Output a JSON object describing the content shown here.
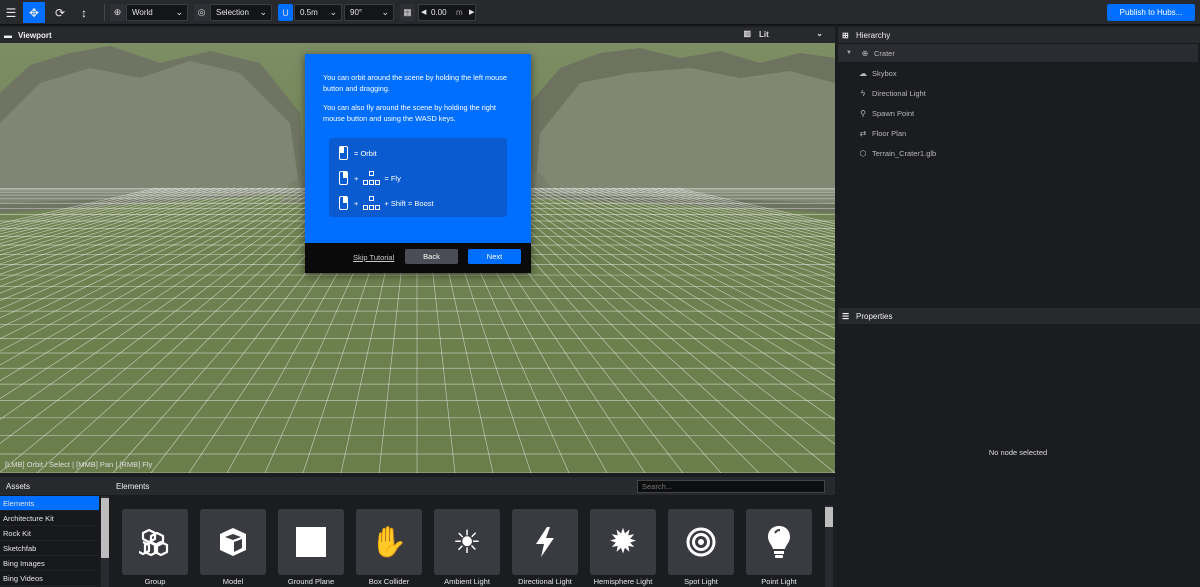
{
  "toolbar": {
    "space_dropdown": "World",
    "pivot_dropdown": "Selection",
    "snap_translate": "0.5m",
    "snap_rotate": "90°",
    "grid_height": "0.00",
    "grid_unit": "m",
    "publish_label": "Publish to Hubs..."
  },
  "viewport": {
    "title": "Viewport",
    "render_mode": "Lit",
    "controls_hint": "[LMB] Orbit / Select | [MMB] Pan | [RMB] Fly"
  },
  "tutorial": {
    "para1": "You can orbit around the scene by holding the left mouse button and dragging.",
    "para2": "You can also fly around the scene by holding the right mouse button and using the WASD keys.",
    "row1": "= Orbit",
    "row2_plus": "+",
    "row2": "= Fly",
    "row3_plus": "+",
    "row3": "+ Shift = Boost",
    "skip_label": "Skip Tutorial",
    "back_label": "Back",
    "next_label": "Next"
  },
  "hierarchy": {
    "title": "Hierarchy",
    "items": [
      {
        "label": "Crater",
        "icon": "globe-icon"
      },
      {
        "label": "Skybox",
        "icon": "cloud-icon"
      },
      {
        "label": "Directional Light",
        "icon": "bolt-icon"
      },
      {
        "label": "Spawn Point",
        "icon": "person-icon"
      },
      {
        "label": "Floor Plan",
        "icon": "shoe-prints-icon"
      },
      {
        "label": "Terrain_Crater1.glb",
        "icon": "cube-icon"
      }
    ]
  },
  "properties": {
    "title": "Properties",
    "empty_message": "No node selected"
  },
  "assets": {
    "title": "Assets",
    "items": [
      "Elements",
      "Architecture Kit",
      "Rock Kit",
      "Sketchfab",
      "Bing Images",
      "Bing Videos"
    ]
  },
  "elements": {
    "title": "Elements",
    "search_placeholder": "Search...",
    "tiles": [
      {
        "label": "Group",
        "icon": "cubes-icon"
      },
      {
        "label": "Model",
        "icon": "cube-icon"
      },
      {
        "label": "Ground Plane",
        "icon": "square-icon"
      },
      {
        "label": "Box Collider",
        "icon": "hand-icon"
      },
      {
        "label": "Ambient Light",
        "icon": "sun-icon"
      },
      {
        "label": "Directional Light",
        "icon": "bolt-icon"
      },
      {
        "label": "Hemisphere Light",
        "icon": "certificate-icon"
      },
      {
        "label": "Spot Light",
        "icon": "bullseye-icon"
      },
      {
        "label": "Point Light",
        "icon": "lightbulb-icon"
      }
    ]
  },
  "colors": {
    "accent": "#006eff",
    "panel": "#1b1c1f",
    "toolbar": "#28292d"
  }
}
